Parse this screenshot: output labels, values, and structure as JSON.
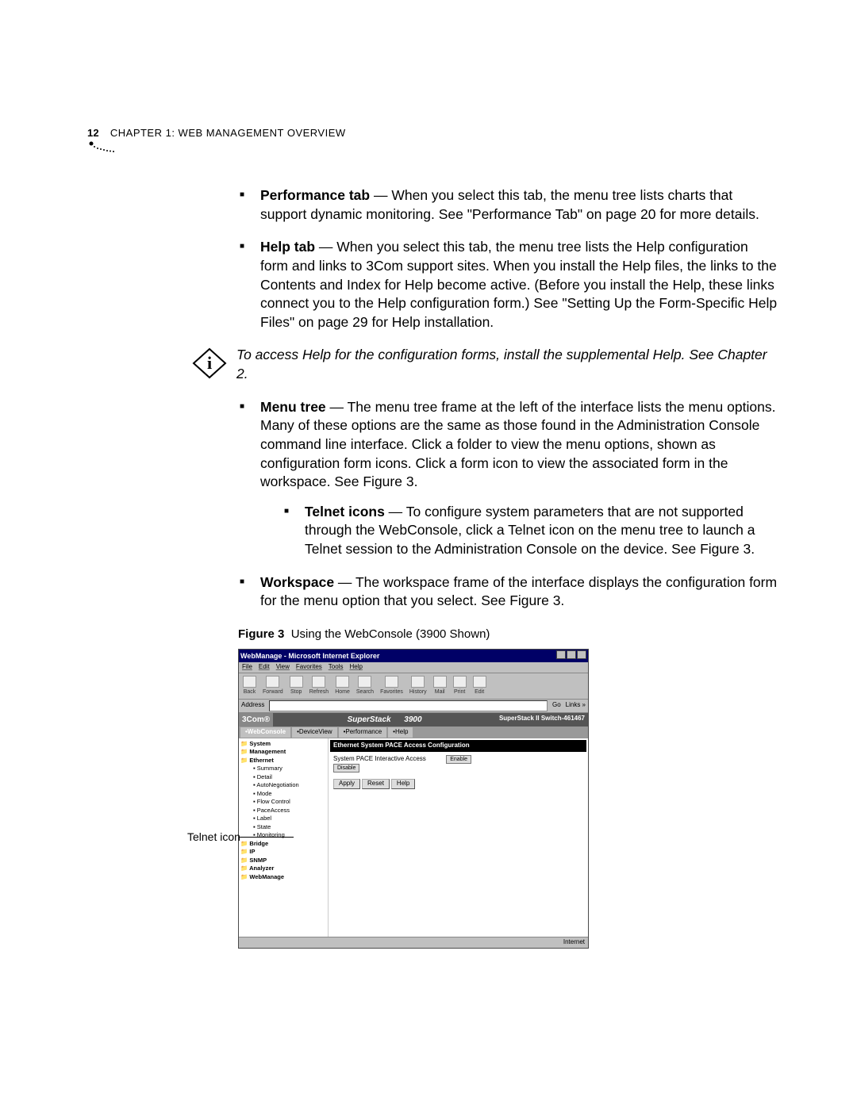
{
  "header": {
    "page_number": "12",
    "chapter_label_1": "C",
    "chapter_label_2": "HAPTER",
    "chapter_label_3": " 1: W",
    "chapter_label_4": "EB",
    "chapter_label_5": " M",
    "chapter_label_6": "ANAGEMENT",
    "chapter_label_7": " O",
    "chapter_label_8": "VERVIEW",
    "chapter_full": "CHAPTER 1: WEB MANAGEMENT OVERVIEW"
  },
  "bullets": {
    "perf_term": "Performance tab",
    "perf_rest": " — When you select this tab, the menu tree lists charts that support dynamic monitoring. See \"Performance Tab\" on page 20 for more details.",
    "help_term": "Help tab",
    "help_rest": " — When you select this tab, the menu tree lists the Help configuration form and links to 3Com support sites. When you install the Help files, the links to the Contents and Index for Help become active. (Before you install the Help, these links connect you to the Help configuration form.) See \"Setting Up the Form-Specific Help Files\" on page 29 for Help installation.",
    "menu_term": "Menu tree",
    "menu_rest": " — The menu tree frame at the left of the interface lists the menu options. Many of these options are the same as those found in the Administration Console command line interface. Click a folder to view the menu options, shown as configuration form icons. Click a form icon to view the associated form in the workspace. See Figure 3.",
    "telnet_term": "Telnet icons",
    "telnet_rest": " — To configure system parameters that are not supported through the WebConsole, click a Telnet icon on the menu tree to launch a Telnet session to the Administration Console on the device. See Figure 3.",
    "work_term": "Workspace",
    "work_rest": " — The workspace frame of the interface displays the configuration form for the menu option that you select. See Figure 3."
  },
  "note_text": "To access Help for the configuration forms, install the supplemental Help. See Chapter 2.",
  "figure": {
    "label": "Figure 3",
    "caption": "Using the WebConsole (3900 Shown)"
  },
  "callout": "Telnet icon",
  "screenshot": {
    "title": "WebManage - Microsoft Internet Explorer",
    "menus": [
      "File",
      "Edit",
      "View",
      "Favorites",
      "Tools",
      "Help"
    ],
    "toolbar": [
      "Back",
      "Forward",
      "Stop",
      "Refresh",
      "Home",
      "Search",
      "Favorites",
      "History",
      "Mail",
      "Print",
      "Edit"
    ],
    "address_label": "Address",
    "go_label": "Go",
    "links_label": "Links »",
    "brand_left": "3Com®",
    "brand_center_left": "SuperStack",
    "brand_center_right": "3900",
    "brand_right": "SuperStack II Switch-461467",
    "tabs": [
      "•WebConsole",
      "•DeviceView",
      "•Performance",
      "•Help"
    ],
    "nav": [
      {
        "t": "System",
        "cls": "fld"
      },
      {
        "t": "Management",
        "cls": "fld"
      },
      {
        "t": "Ethernet",
        "cls": "fld"
      },
      {
        "t": "Summary",
        "cls": "ind2"
      },
      {
        "t": "Detail",
        "cls": "ind2"
      },
      {
        "t": "AutoNegotiation",
        "cls": "ind2"
      },
      {
        "t": "Mode",
        "cls": "ind2"
      },
      {
        "t": "Flow Control",
        "cls": "ind2"
      },
      {
        "t": "PaceAccess",
        "cls": "ind2"
      },
      {
        "t": "Label",
        "cls": "ind2"
      },
      {
        "t": "State",
        "cls": "ind2"
      },
      {
        "t": "Monitoring",
        "cls": "ind2"
      },
      {
        "t": "Bridge",
        "cls": "fld"
      },
      {
        "t": "IP",
        "cls": "fld"
      },
      {
        "t": "SNMP",
        "cls": "fld"
      },
      {
        "t": "Analyzer",
        "cls": "fld"
      },
      {
        "t": "WebManage",
        "cls": "fld"
      }
    ],
    "panel_title": "Ethernet System PACE Access Configuration",
    "pace_label": "System PACE Interactive Access",
    "enable": "Enable",
    "disable": "Disable",
    "apply": "Apply",
    "reset": "Reset",
    "help": "Help",
    "status_right": "Internet"
  }
}
